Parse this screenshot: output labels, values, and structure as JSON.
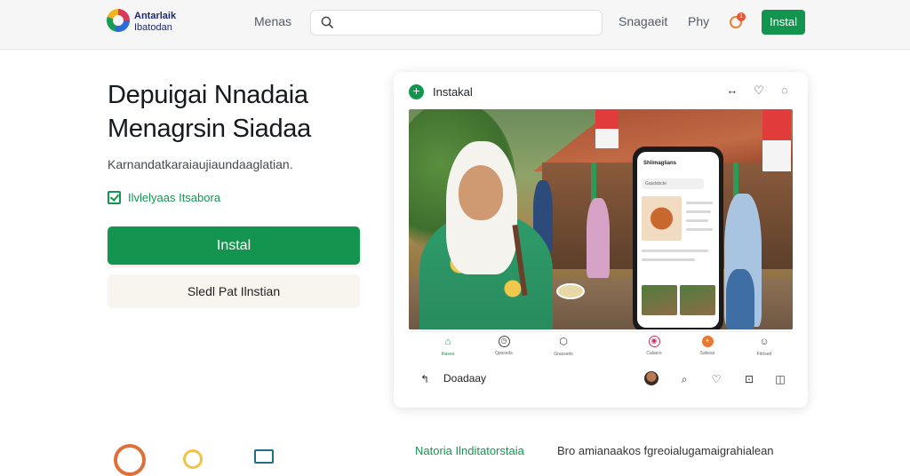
{
  "header": {
    "logo_line1": "Antarlaik",
    "logo_line2": "Ibatodan",
    "menu_label": "Menas",
    "search_placeholder": "",
    "nav_links": [
      "Snagaeit",
      "Phy"
    ],
    "notification_count": "1",
    "install_button": "Instal"
  },
  "hero": {
    "title": "Depuigai Nnadaia Menagrsin Siadaa",
    "subtitle": "Karnandatkaraiaujiaundaaglatian.",
    "checkbox_label": "Ilvlelyaas Itsabora",
    "primary_button": "Instal",
    "secondary_button": "Sledl Pat Ilnstian"
  },
  "preview": {
    "title": "Instakal",
    "phone_header": "Shlimaglians",
    "phone_search": "Gasdsbcte",
    "tabs": [
      {
        "label": "Ihaves"
      },
      {
        "label": "Qpsseds"
      },
      {
        "label": "Grasseds"
      },
      {
        "label": "Calaers"
      },
      {
        "label": "Sakeas"
      },
      {
        "label": "Fitrlsed"
      }
    ],
    "bottom_text": "Doadaay"
  },
  "footer": {
    "green_text": "Natoria Ilnditatorstaia",
    "text": "Bro amianaakos fgreoialugamaigrahialean"
  },
  "colors": {
    "accent": "#14954f",
    "notification": "#e8552f"
  }
}
